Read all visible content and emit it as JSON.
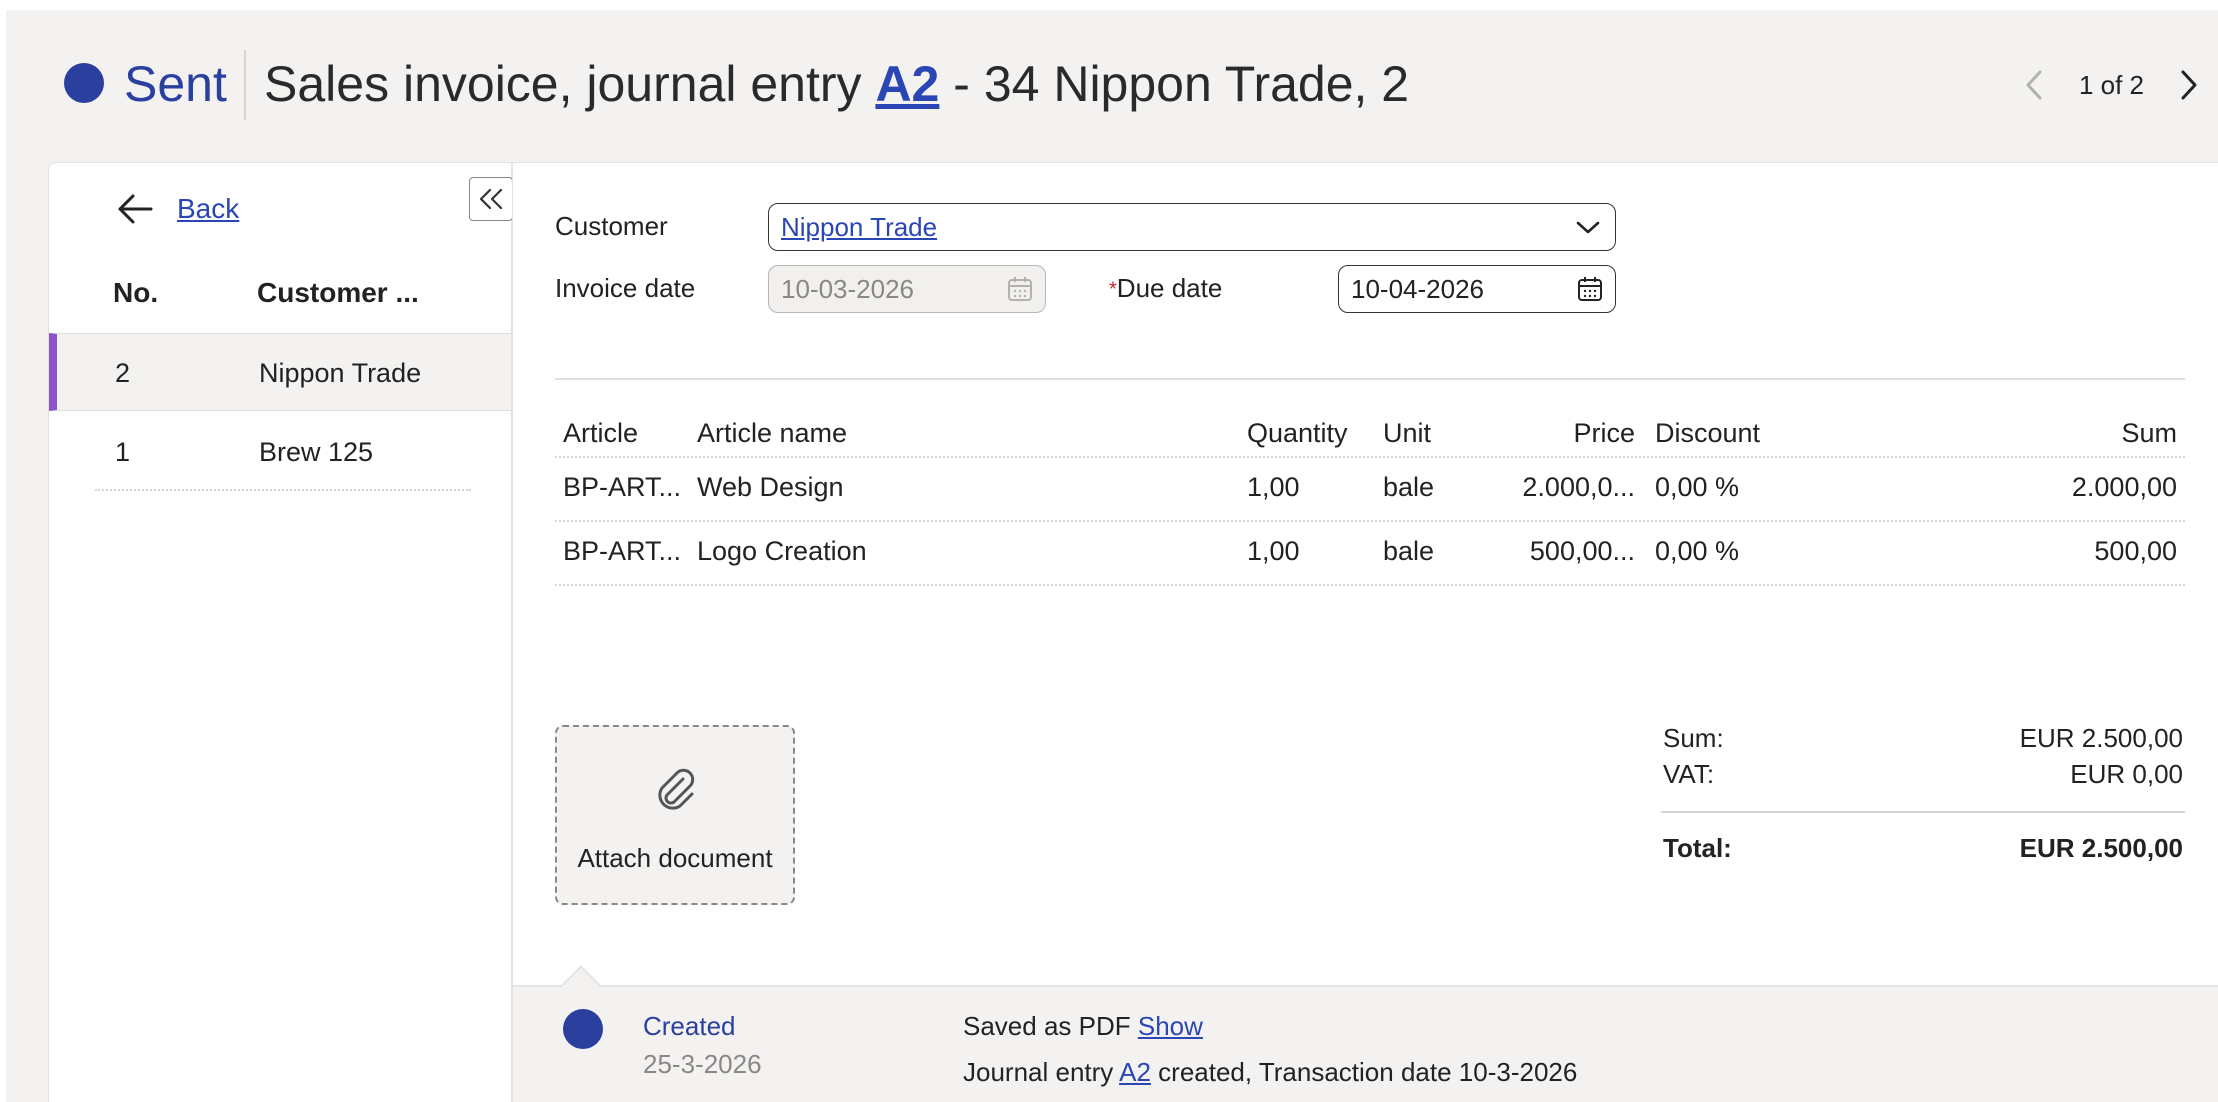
{
  "header": {
    "status": "Sent",
    "title_prefix": "Sales invoice, journal entry",
    "title_entry": "A2",
    "title_suffix": "- 34 Nippon Trade, 2",
    "pager_text": "1 of 2"
  },
  "sidebar": {
    "back_label": "Back",
    "columns": {
      "no": "No.",
      "customer": "Customer ..."
    },
    "rows": [
      {
        "no": "2",
        "customer": "Nippon Trade"
      },
      {
        "no": "1",
        "customer": "Brew 125"
      }
    ]
  },
  "form": {
    "customer_label": "Customer",
    "customer_value": "Nippon Trade",
    "invoice_date_label": "Invoice date",
    "invoice_date_value": "10-03-2026",
    "due_date_required_mark": "*",
    "due_date_label": "Due date",
    "due_date_value": "10-04-2026"
  },
  "lines": {
    "headers": {
      "article": "Article",
      "name": "Article name",
      "quantity": "Quantity",
      "unit": "Unit",
      "price": "Price",
      "discount": "Discount",
      "sum": "Sum"
    },
    "rows": [
      {
        "article": "BP-ART...",
        "name": "Web Design",
        "quantity": "1,00",
        "unit": "bale",
        "price": "2.000,0...",
        "discount": "0,00 %",
        "sum": "2.000,00"
      },
      {
        "article": "BP-ART...",
        "name": "Logo Creation",
        "quantity": "1,00",
        "unit": "bale",
        "price": "500,00...",
        "discount": "0,00 %",
        "sum": "500,00"
      }
    ]
  },
  "attach": {
    "label": "Attach document"
  },
  "totals": {
    "sum_label": "Sum:",
    "sum_value": "EUR 2.500,00",
    "vat_label": "VAT:",
    "vat_value": "EUR 0,00",
    "total_label": "Total:",
    "total_value": "EUR 2.500,00"
  },
  "activity": {
    "status": "Created",
    "date": "25-3-2026",
    "line1_text": "Saved as PDF",
    "line1_link": "Show",
    "line2_prefix": "Journal entry",
    "line2_link": "A2",
    "line2_suffix": "created, Transaction date 10-3-2026"
  },
  "colors": {
    "accent": "#2b3f9e",
    "link": "#2a46b4",
    "selected_marker": "#8a55c9",
    "required": "#c4262e"
  },
  "icons": [
    "chevron-left-icon",
    "chevron-right-icon",
    "arrow-left-icon",
    "double-chevron-left-icon",
    "chevron-down-icon",
    "calendar-icon",
    "paperclip-icon"
  ]
}
